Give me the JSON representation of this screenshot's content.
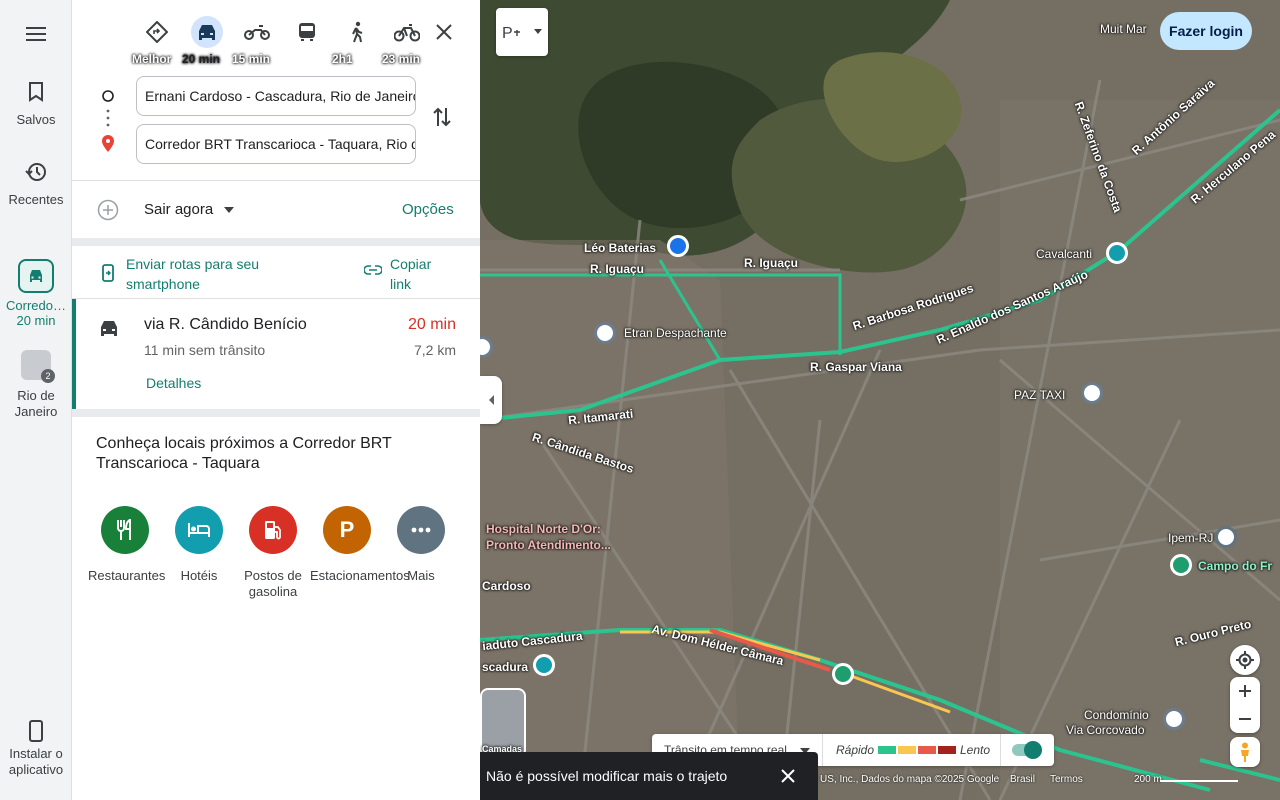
{
  "rail": {
    "menu_icon": "hamburger-icon",
    "saved_label": "Salvos",
    "recent_label": "Recentes",
    "route_label": "Corredo…",
    "route_time": "20 min",
    "place_label": "Rio de Janeiro",
    "place_badge": "2",
    "install_label": "Instalar o aplicativo"
  },
  "modes": [
    {
      "icon": "best-route-icon",
      "label": "Melhor"
    },
    {
      "icon": "car-icon",
      "label": "20 min",
      "active": true
    },
    {
      "icon": "motorcycle-icon",
      "label": "15 min"
    },
    {
      "icon": "transit-icon",
      "label": ""
    },
    {
      "icon": "walk-icon",
      "label": "2h1"
    },
    {
      "icon": "bicycle-icon",
      "label": "23 min"
    }
  ],
  "origin": "Ernani Cardoso - Cascadura, Rio de Janeiro",
  "destination": "Corredor BRT Transcarioca - Taquara, Rio de Janeiro",
  "leave_now": "Sair agora",
  "options": "Opções",
  "send_to_phone": "Enviar rotas para seu smartphone",
  "copy_link": "Copiar link",
  "route": {
    "via": "via R. Cândido Benício",
    "time": "20 min",
    "traffic_note": "11 min sem trânsito",
    "distance": "7,2 km",
    "details": "Detalhes"
  },
  "nearby_title": "Conheça locais próximos a Corredor BRT Transcarioca - Taquara",
  "categories": [
    {
      "label": "Restaurantes",
      "color": "#188038",
      "icon": "restaurant-icon"
    },
    {
      "label": "Hotéis",
      "color": "#129eaf",
      "icon": "hotel-icon"
    },
    {
      "label": "Postos de gasolina",
      "color": "#d93025",
      "icon": "gas-station-icon"
    },
    {
      "label": "Estacionamentos",
      "color": "#c26401",
      "icon": "parking-icon"
    },
    {
      "label": "Mais",
      "color": "#5f7380",
      "icon": "more-icon"
    }
  ],
  "map": {
    "login": "Fazer login",
    "top_label": "Muit Mar",
    "labels": {
      "leo": "Léo Baterias",
      "iguacu1": "R. Iguaçu",
      "iguacu2": "R. Iguaçu",
      "etran": "Etran Despachante",
      "barbosa": "R. Barbosa Rodrigues",
      "cavalcanti": "Cavalcanti",
      "gaspar": "R. Gaspar Viana",
      "enaldo": "R. Enaldo dos Santos Araújo",
      "paz": "PAZ TAXI",
      "itamarati": "R. Itamarati",
      "candida": "R. Cândida Bastos",
      "hospital1": "Hospital Norte D'Or:",
      "hospital2": "Pronto Atendimento...",
      "cardoso": "Cardoso",
      "ipem": "Ipem-RJ",
      "campo": "Campo do Fr",
      "viaduto": "iaduto Cascadura",
      "scadura": "scadura",
      "helder": "Av. Dom Hélder Câmara",
      "ouro": "R. Ouro Preto",
      "condominio1": "Condomínio",
      "condominio2": "Via Corcovado",
      "camadas": "Camadas",
      "zeferino": "R. Zeferino da Costa",
      "saraiva": "R. Antônio Saraiva",
      "herculano": "R. Herculano Pena"
    },
    "traffic": {
      "label": "Trânsito em tempo real",
      "fast": "Rápido",
      "slow": "Lento",
      "colors": [
        "#2bc48f",
        "#f9c74f",
        "#e8594a",
        "#a3231c"
      ]
    },
    "toast": "Não é possível modificar mais o trajeto",
    "attribution": {
      "imagery": "US, Inc., Dados do mapa ©2025 Google",
      "country": "Brasil",
      "terms": "Termos",
      "scale": "200 m"
    }
  }
}
